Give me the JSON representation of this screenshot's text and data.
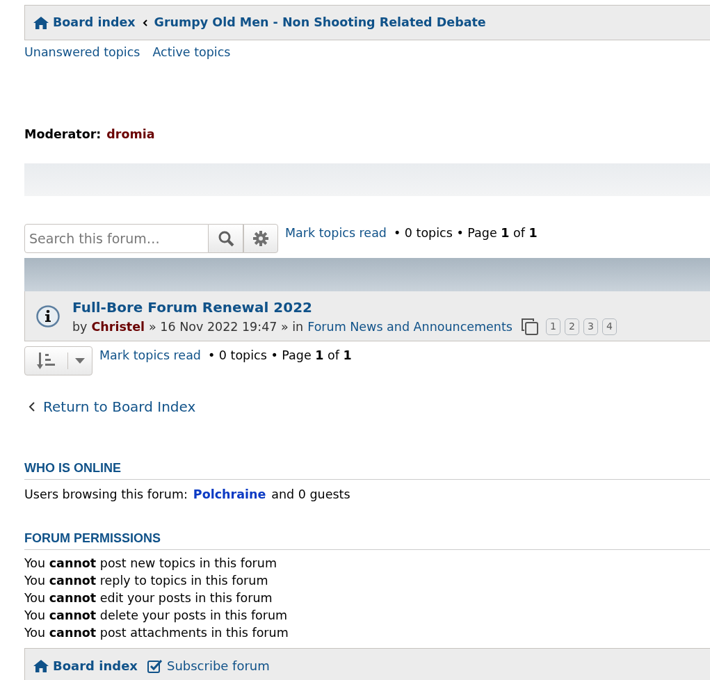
{
  "breadcrumbs": [
    {
      "label": "Board index",
      "kind": "home"
    },
    {
      "label": "Grumpy Old Men - Non Shooting Related Debate",
      "kind": "forum"
    }
  ],
  "quick_links": [
    "Unanswered topics",
    "Active topics"
  ],
  "moderator": {
    "label": "Moderator:",
    "name": "dromia"
  },
  "search": {
    "placeholder": "Search this forum…"
  },
  "pagination_top": {
    "mark_read": "Mark topics read",
    "text": "• 0 topics • Page **1** of **1**"
  },
  "topics": [
    {
      "title": "Full-Bore Forum Renewal 2022",
      "by": "by",
      "author": "Christel",
      "date": "» 16 Nov 2022 19:47 » in",
      "forum": "Forum News and Announcements",
      "pages": [
        "1",
        "2",
        "3",
        "4"
      ]
    }
  ],
  "pagination_bottom": {
    "mark_read": "Mark topics read",
    "text": "• 0 topics • Page **1** of **1**"
  },
  "return_link": "Return to Board Index",
  "who_is_online": {
    "heading": "WHO IS ONLINE",
    "prefix": "Users browsing this forum:",
    "user": "Polchraine",
    "suffix": "and 0 guests"
  },
  "permissions": {
    "heading": "FORUM PERMISSIONS",
    "lines": [
      "You **cannot** post new topics in this forum",
      "You **cannot** reply to topics in this forum",
      "You **cannot** edit your posts in this forum",
      "You **cannot** delete your posts in this forum",
      "You **cannot** post attachments in this forum"
    ]
  },
  "footer": [
    {
      "label": "Board index",
      "kind": "home"
    },
    {
      "label": "Subscribe forum",
      "kind": "subscribe"
    }
  ]
}
